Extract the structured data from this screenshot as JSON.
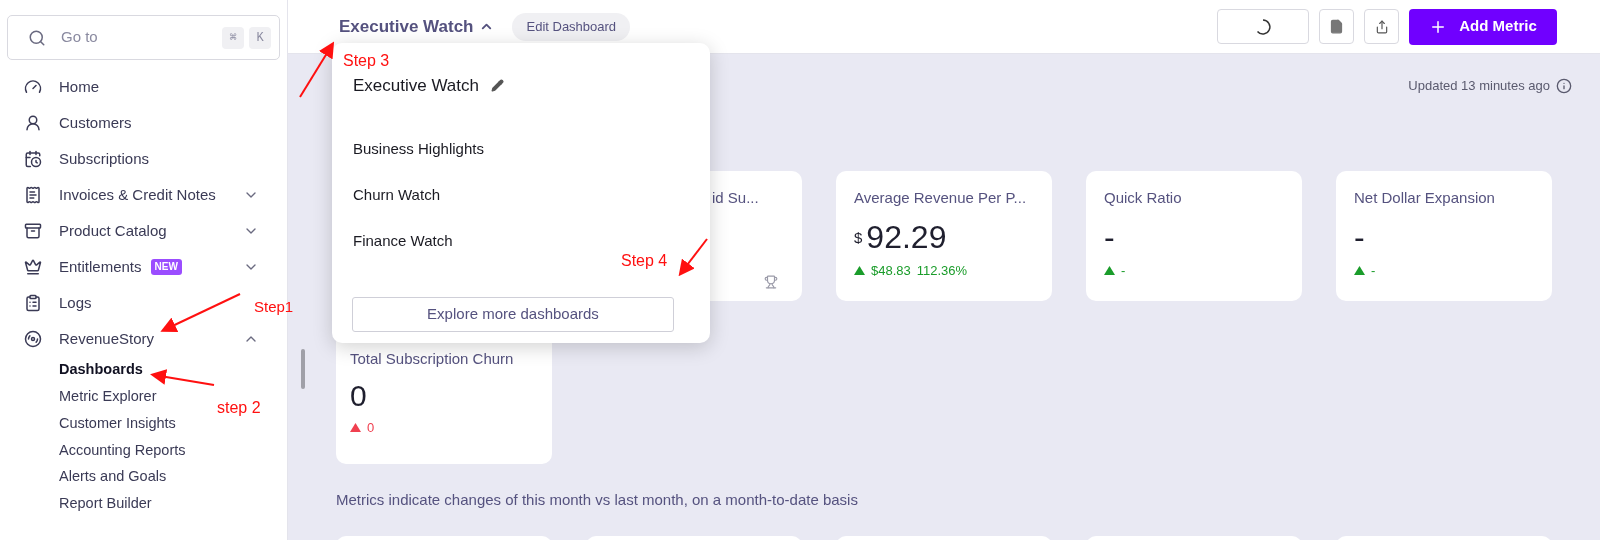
{
  "sidebar": {
    "search": {
      "placeholder": "Go to",
      "shortcut": [
        "⌘",
        "K"
      ]
    },
    "items": [
      {
        "label": "Home"
      },
      {
        "label": "Customers"
      },
      {
        "label": "Subscriptions"
      },
      {
        "label": "Invoices & Credit Notes",
        "expanded": false
      },
      {
        "label": "Product Catalog",
        "expanded": false
      },
      {
        "label": "Entitlements",
        "badge": "NEW",
        "expanded": false
      },
      {
        "label": "Logs"
      },
      {
        "label": "RevenueStory",
        "expanded": true,
        "children": [
          {
            "label": "Dashboards",
            "selected": true
          },
          {
            "label": "Metric Explorer",
            "selected": false
          },
          {
            "label": "Customer Insights",
            "selected": false
          },
          {
            "label": "Accounting Reports",
            "selected": false
          },
          {
            "label": "Alerts and Goals",
            "selected": false
          },
          {
            "label": "Report Builder",
            "selected": false
          }
        ]
      }
    ]
  },
  "header": {
    "title": "Executive Watch",
    "menu_open": true,
    "edit_button": "Edit Dashboard",
    "add_button": "Add Metric"
  },
  "dropdown": {
    "current": "Executive Watch",
    "items": [
      "Business Highlights",
      "Churn Watch",
      "Finance Watch"
    ],
    "footer_button": "Explore more dashboards"
  },
  "updated": "Updated 13 minutes ago",
  "metrics": [
    {
      "title": "id Su...",
      "trophy": true
    },
    {
      "title": "Average Revenue Per P...",
      "currency": "$",
      "value": "92.29",
      "color": "#1a9c2a",
      "delta": "$48.83",
      "percent": "112.36%"
    },
    {
      "title": "Quick Ratio",
      "value": "-",
      "color": "#1a9c2a",
      "delta": "-"
    },
    {
      "title": "Net Dollar Expansion",
      "value": "-",
      "color": "#1a9c2a",
      "delta": "-"
    }
  ],
  "churn": {
    "title": "Total Subscription Churn",
    "value": "0",
    "color": "#f04050",
    "delta": "0"
  },
  "note": "Metrics indicate changes of this month vs last month, on a month-to-date basis",
  "annotations": [
    {
      "text": "Step 3"
    },
    {
      "text": "Step 4"
    },
    {
      "text": "Step1"
    },
    {
      "text": "step 2"
    }
  ]
}
